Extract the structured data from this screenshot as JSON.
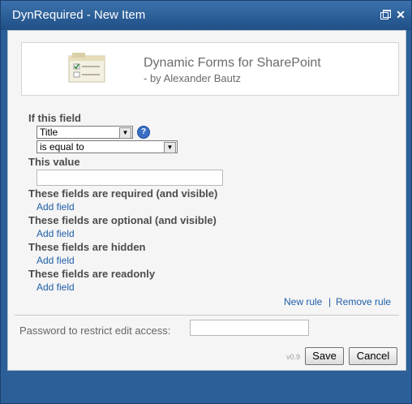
{
  "window": {
    "title": "DynRequired - New Item"
  },
  "header": {
    "app_title": "Dynamic Forms for SharePoint",
    "author": "- by Alexander Bautz"
  },
  "form": {
    "if_field_label": "If this field",
    "field_select_value": "Title",
    "operator_select_value": "is equal to",
    "this_value_label": "This value",
    "this_value_input": "",
    "sections": [
      {
        "label": "These fields are required (and visible)",
        "link": "Add field"
      },
      {
        "label": "These fields are optional (and visible)",
        "link": "Add field"
      },
      {
        "label": "These fields are hidden",
        "link": "Add field"
      },
      {
        "label": "These fields are readonly",
        "link": "Add field"
      }
    ],
    "new_rule": "New rule",
    "separator": "|",
    "remove_rule": "Remove rule"
  },
  "footer": {
    "password_label": "Password to restrict edit access:",
    "password_value": "",
    "version": "v0.9",
    "save": "Save",
    "cancel": "Cancel"
  },
  "icons": [
    "restore-icon",
    "close-icon",
    "form-logo-icon",
    "help-icon",
    "chevron-down-icon"
  ]
}
